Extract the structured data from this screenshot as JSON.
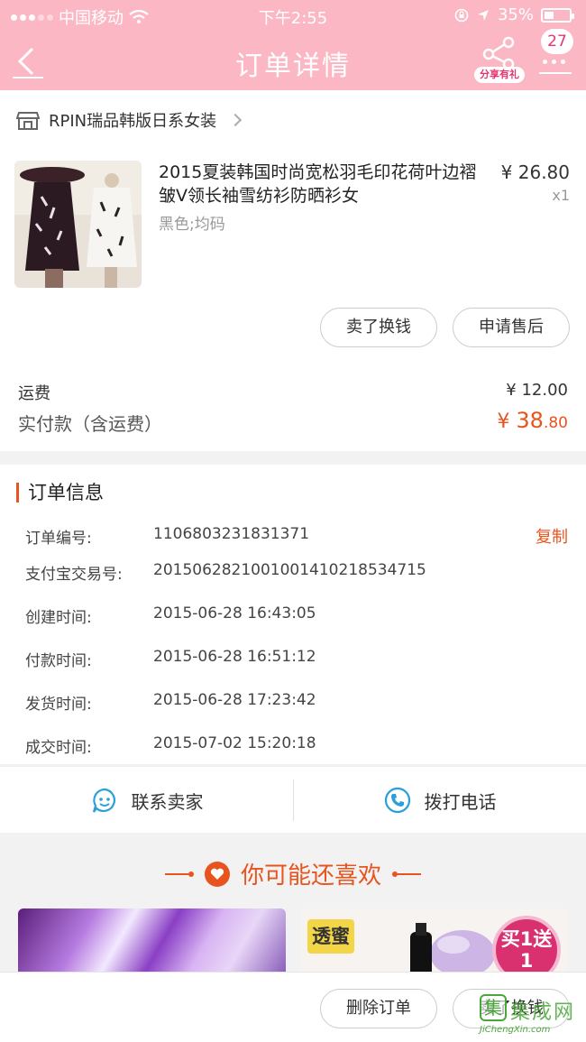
{
  "status_bar": {
    "carrier": "中国移动",
    "time": "下午2:55",
    "battery": "35%"
  },
  "nav": {
    "title": "订单详情",
    "share_label": "分享有礼",
    "badge_count": "27"
  },
  "shop": {
    "name": "RPIN瑞品韩版日系女装"
  },
  "product": {
    "title": "2015夏装韩国时尚宽松羽毛印花荷叶边褶皱V领长袖雪纺衫防晒衫女",
    "sku": "黑色;均码",
    "price": "¥ 26.80",
    "qty": "x1",
    "sell_button": "卖了换钱",
    "after_sale_button": "申请售后"
  },
  "payment": {
    "shipping_label": "运费",
    "shipping_value": "¥ 12.00",
    "paid_label": "实付款（含运费）",
    "paid_currency": "¥ ",
    "paid_int": "38",
    "paid_dec": ".80"
  },
  "order_info": {
    "title": "订单信息",
    "copy_label": "复制",
    "rows": [
      {
        "key": "订单编号:",
        "value": "1106803231831371"
      },
      {
        "key": "支付宝交易号:",
        "value": "2015062821001001410218534715"
      },
      {
        "key": "创建时间:",
        "value": "2015-06-28 16:43:05"
      },
      {
        "key": "付款时间:",
        "value": "2015-06-28 16:51:12"
      },
      {
        "key": "发货时间:",
        "value": "2015-06-28 17:23:42"
      },
      {
        "key": "成交时间:",
        "value": "2015-07-02 15:20:18"
      }
    ]
  },
  "contact": {
    "seller_label": "联系卖家",
    "phone_label": "拨打电话"
  },
  "recommend": {
    "title": "你可能还喜欢",
    "tag_left": "透蜜",
    "promo": "买1送1"
  },
  "bottom": {
    "delete_label": "删除订单",
    "sell_label": "卖了换钱"
  },
  "watermark": {
    "text": "集成网",
    "url": "JiChengXin.com"
  },
  "colors": {
    "header_pink": "#fbb8c4",
    "accent_orange": "#e8541e",
    "icon_blue": "#2aa0d8"
  }
}
